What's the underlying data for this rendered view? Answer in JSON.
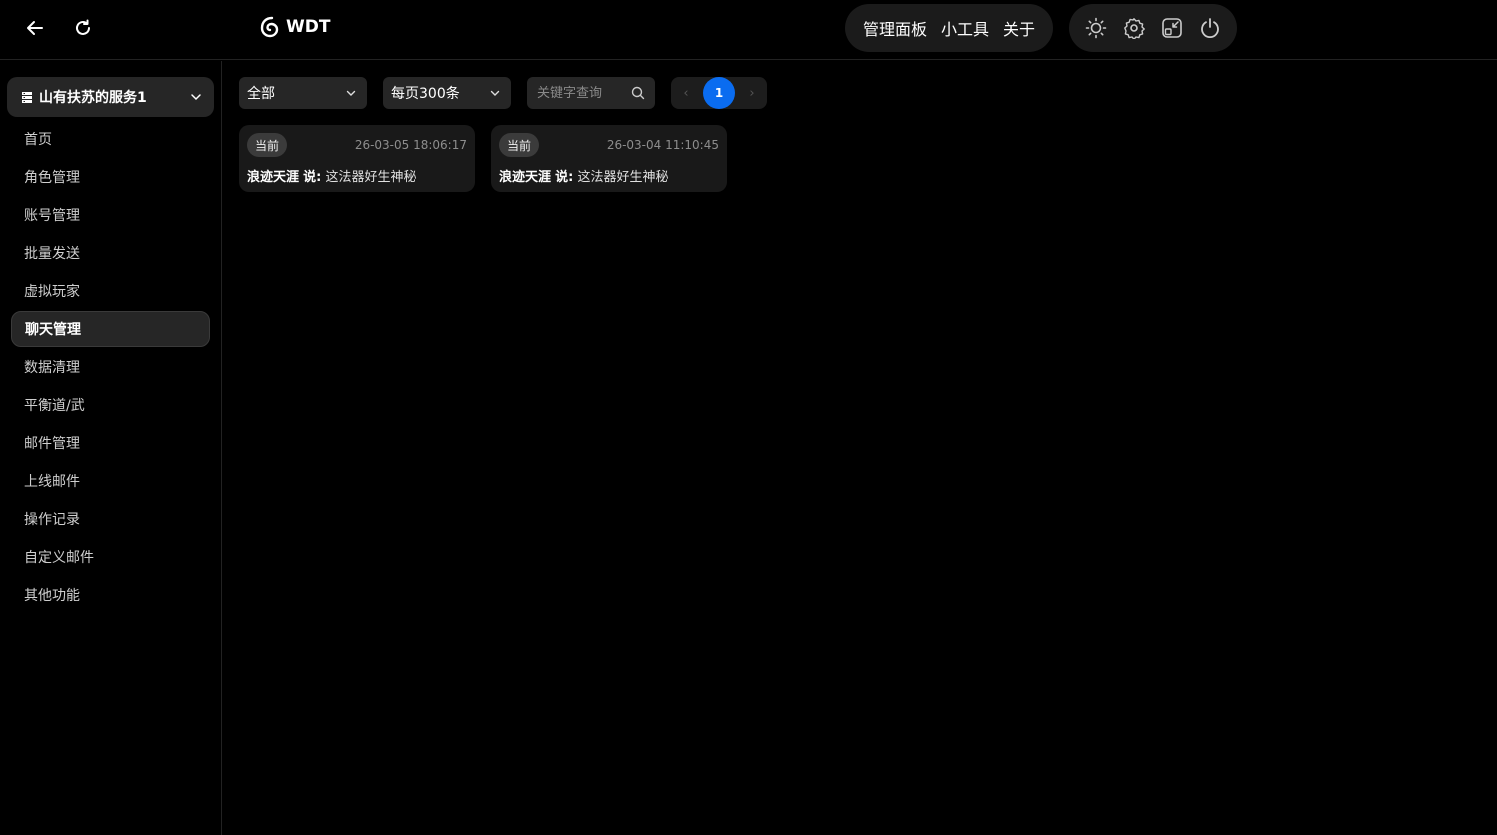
{
  "header": {
    "logo_text": "WDT",
    "nav": [
      "管理面板",
      "小工具",
      "关于"
    ]
  },
  "sidebar": {
    "server": "山有扶苏的服务1",
    "items": [
      {
        "label": "首页"
      },
      {
        "label": "角色管理"
      },
      {
        "label": "账号管理"
      },
      {
        "label": "批量发送"
      },
      {
        "label": "虚拟玩家"
      },
      {
        "label": "聊天管理",
        "active": true
      },
      {
        "label": "数据清理"
      },
      {
        "label": "平衡道/武"
      },
      {
        "label": "邮件管理"
      },
      {
        "label": "上线邮件"
      },
      {
        "label": "操作记录"
      },
      {
        "label": "自定义邮件"
      },
      {
        "label": "其他功能"
      }
    ]
  },
  "toolbar": {
    "filter_value": "全部",
    "page_size_value": "每页300条",
    "search_placeholder": "关键字查询",
    "current_page": "1"
  },
  "chats": [
    {
      "badge": "当前",
      "time": "26-03-05 18:06:17",
      "sender": "浪迹天涯",
      "says": "说:",
      "text": "这法器好生神秘"
    },
    {
      "badge": "当前",
      "time": "26-03-04 11:10:45",
      "sender": "浪迹天涯",
      "says": "说:",
      "text": "这法器好生神秘"
    }
  ],
  "colors": {
    "accent": "#0a6cf0",
    "background": "#000000",
    "panel": "#262626"
  }
}
